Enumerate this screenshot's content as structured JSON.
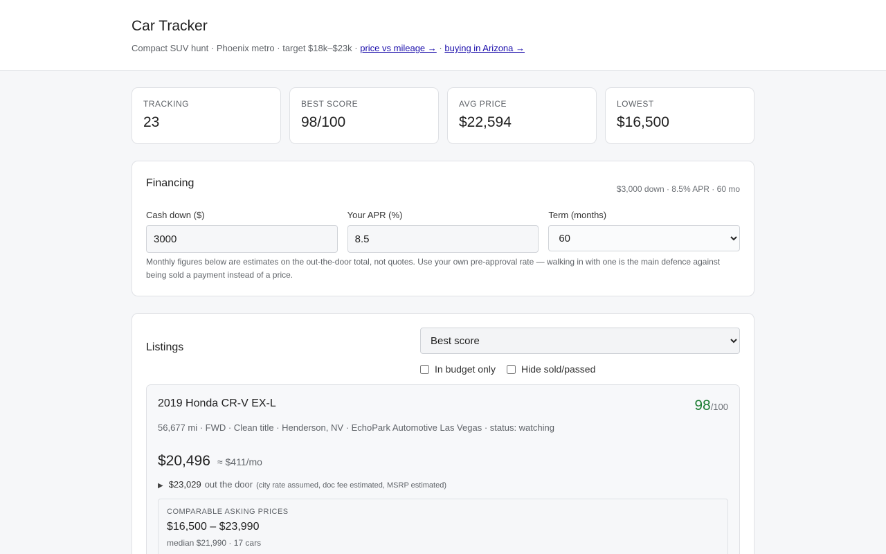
{
  "header": {
    "title": "Car Tracker",
    "subtitle_text": "Compact SUV hunt · Phoenix metro · target $18k–$23k ·",
    "link1": "price vs mileage →",
    "sep": "·",
    "link2": "buying in Arizona →"
  },
  "stats": [
    {
      "label": "TRACKING",
      "value": "23"
    },
    {
      "label": "BEST SCORE",
      "value": "98/100"
    },
    {
      "label": "AVG PRICE",
      "value": "$22,594"
    },
    {
      "label": "LOWEST",
      "value": "$16,500"
    }
  ],
  "financing": {
    "title": "Financing",
    "summary": "$3,000 down · 8.5% APR · 60 mo",
    "cash_label": "Cash down ($)",
    "cash_value": "3000",
    "apr_label": "Your APR (%)",
    "apr_value": "8.5",
    "term_label": "Term (months)",
    "term_value": "60",
    "note": "Monthly figures below are estimates on the out-the-door total, not quotes. Use your own pre-approval rate — walking in with one is the main defence against being sold a payment instead of a price."
  },
  "listings": {
    "title": "Listings",
    "sort_value": "Best score",
    "filter_budget": "In budget only",
    "filter_hide": "Hide sold/passed",
    "cars": [
      {
        "title": "2019 Honda CR-V EX-L",
        "score": "98",
        "score_max": "/100",
        "meta": "56,677 mi · FWD · Clean title · Henderson, NV · EchoPark Automotive Las Vegas · status: watching",
        "price": "$20,496",
        "monthly": "≈ $411/mo",
        "otd_value": "$23,029",
        "otd_label": "out the door",
        "otd_note": "(city rate assumed, doc fee estimated, MSRP estimated)",
        "comps_label": "COMPARABLE ASKING PRICES",
        "comps_range": "$16,500 – $23,990",
        "comps_sub": "median $21,990 · 17 cars"
      }
    ]
  }
}
